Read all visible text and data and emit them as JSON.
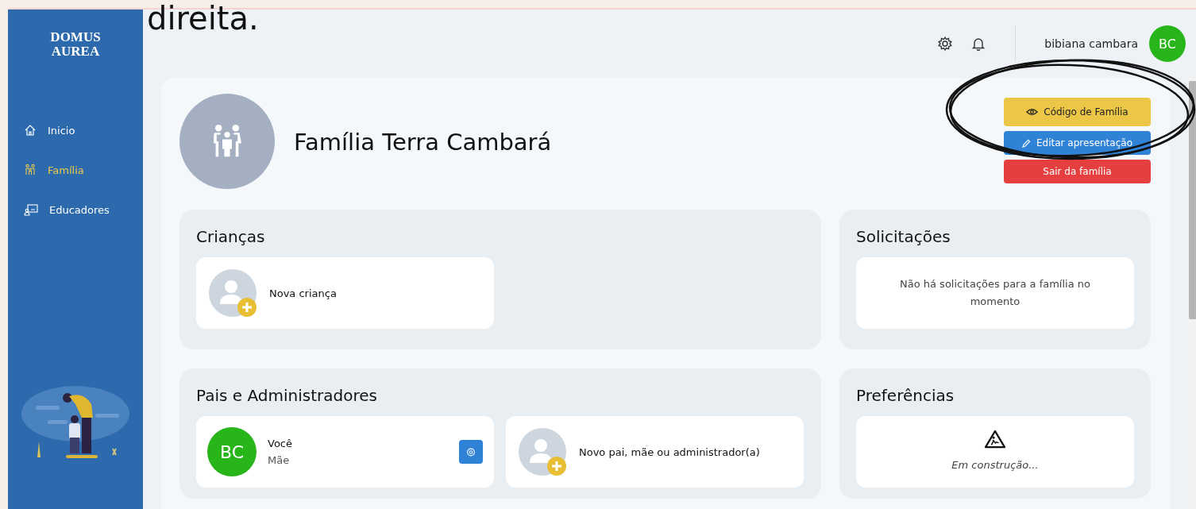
{
  "caption": "direita.",
  "sidebar": {
    "logo": [
      "DOMUS",
      "AUREA"
    ],
    "items": [
      {
        "label": "Inicio",
        "kind": "home",
        "selected": false
      },
      {
        "label": "Família",
        "kind": "family",
        "selected": true
      },
      {
        "label": "Educadores",
        "kind": "teacher",
        "selected": false
      }
    ],
    "illustration": {
      "kind": "picture"
    }
  },
  "header": {
    "user_name": "bibiana cambara",
    "avatar_initials": "BC"
  },
  "family": {
    "name": "Família Terra Cambará",
    "buttons": [
      {
        "label": "Código de Família",
        "kind": "code"
      },
      {
        "label": "Editar apresentação",
        "kind": "edit"
      },
      {
        "label": "Sair da família",
        "kind": "leave"
      }
    ]
  },
  "children_section": {
    "title": "Crianças",
    "add_label": "Nova criança"
  },
  "requests_section": {
    "title": "Solicitações",
    "message": "Não há solicitações para a família no momento"
  },
  "parents_section": {
    "title": "Pais e Administradores",
    "members": [
      {
        "initials": "BC",
        "name": "Você",
        "role": "Mãe"
      }
    ],
    "add_label": "Novo pai, mãe ou administrador(a)"
  },
  "preferences_section": {
    "title": "Preferências",
    "message": "Em construção..."
  }
}
